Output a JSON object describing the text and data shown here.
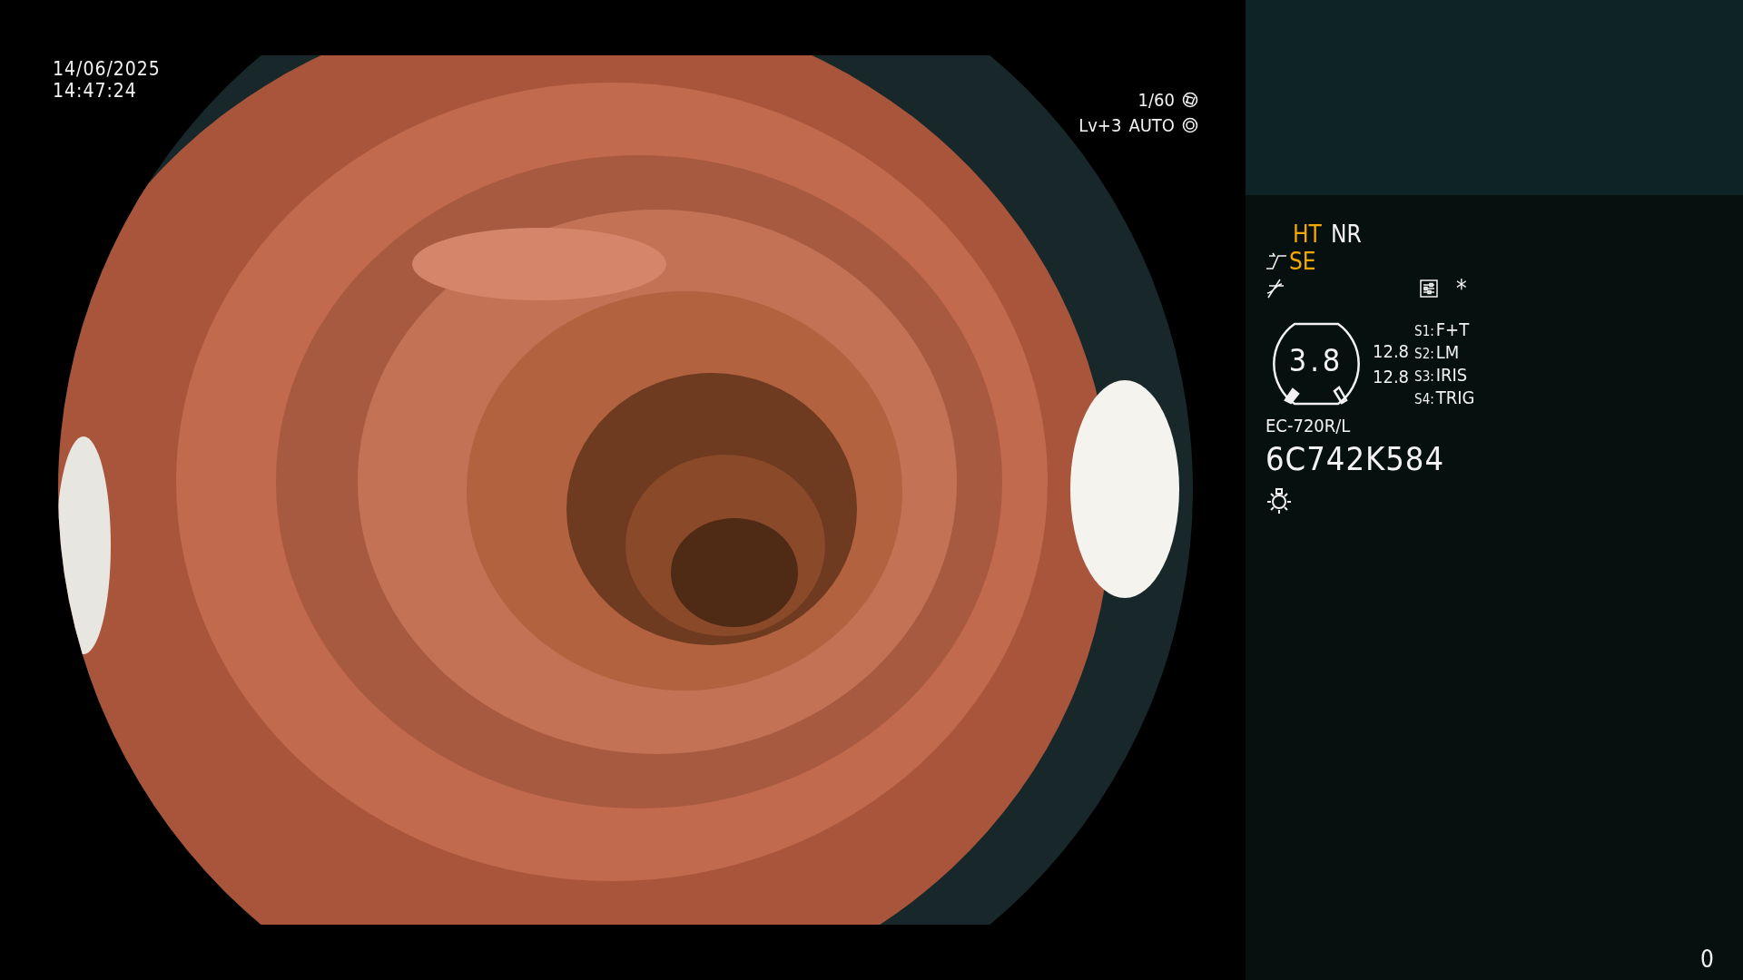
{
  "overlay": {
    "date": "14/06/2025",
    "time": "14:47:24",
    "shutter": "1/60",
    "exposure_level": "Lv+3",
    "exposure_mode": "AUTO"
  },
  "status_panel": {
    "modes": [
      {
        "label": "HT",
        "active": true
      },
      {
        "label": "NR",
        "active": false
      }
    ],
    "structure_enhance": {
      "label": "SE",
      "active": true
    },
    "asterisk": "*",
    "gauge": {
      "value": "3.8"
    },
    "readings": [
      "12.8",
      "12.8"
    ],
    "switches": [
      {
        "key": "S1:",
        "value": "F+T"
      },
      {
        "key": "S2:",
        "value": "LM"
      },
      {
        "key": "S3:",
        "value": "IRIS"
      },
      {
        "key": "S4:",
        "value": "TRIG"
      }
    ],
    "scope_model": "EC-720R/L",
    "serial": "6C742K584"
  },
  "counter": "0"
}
